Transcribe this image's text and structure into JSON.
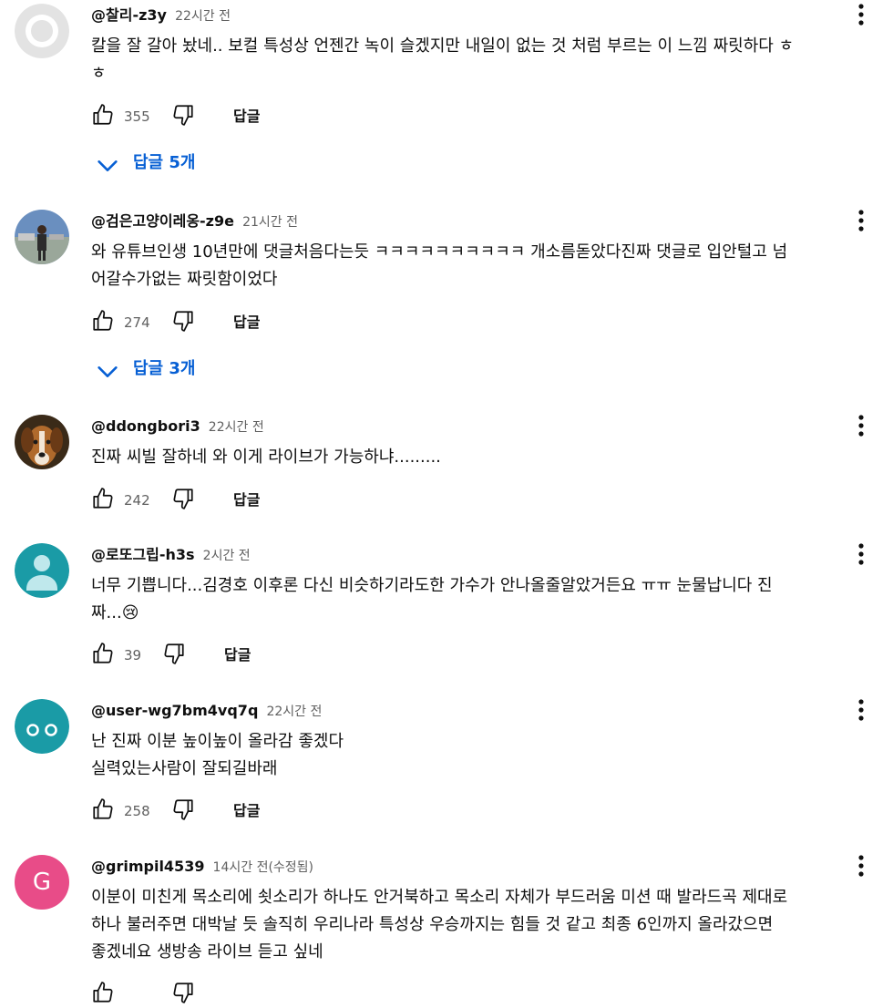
{
  "comments": [
    {
      "author": "@찰리-z3y",
      "time": "22시간 전",
      "text": "칼을 잘 갈아 놨네.. 보컬 특성상 언젠간 녹이 슬겠지만 내일이 없는 것 처럼 부르는 이 느낌 짜릿하다 ㅎ\nㅎ",
      "likes": "355",
      "reply_label": "답글",
      "replies_label": "답글 5개"
    },
    {
      "author": "@검은고양이레옹-z9e",
      "time": "21시간 전",
      "text": "와 유튜브인생 10년만에 댓글처음다는듯 ㅋㅋㅋㅋㅋㅋㅋㅋㅋㅋ 개소름돋았다진짜 댓글로 입안털고 넘\n어갈수가없는 짜릿함이었다",
      "likes": "274",
      "reply_label": "답글",
      "replies_label": "답글 3개"
    },
    {
      "author": "@ddongbori3",
      "time": "22시간 전",
      "text": "진짜 씨빌 잘하네 와 이게 라이브가 가능하냐.........",
      "likes": "242",
      "reply_label": "답글"
    },
    {
      "author": "@로또그립-h3s",
      "time": "2시간 전",
      "text": "너무 기쁩니다...김경호 이후론 다신 비슷하기라도한 가수가 안나올줄알았거든요 ㅠㅠ 눈물납니다 진\n짜...😢",
      "likes": "39",
      "reply_label": "답글"
    },
    {
      "author": "@user-wg7bm4vq7q",
      "time": "22시간 전",
      "text": "난 진짜 이분 높이높이 올라감 좋겠다\n실력있는사람이 잘되길바래",
      "likes": "258",
      "reply_label": "답글"
    },
    {
      "author": "@grimpil4539",
      "time": "14시간 전(수정됨)",
      "text": "이분이 미친게 목소리에 쇳소리가 하나도 안거북하고 목소리 자체가 부드러움 미션 때 발라드곡 제대로\n하나 불러주면 대박날 듯 솔직히 우리나라 특성상 우승까지는 힘들 것 같고 최종 6인까지 올라갔으면\n좋겠네요 생방송 라이브 듣고 싶네",
      "avatar_letter": "G",
      "avatar_color": "#e84c88"
    }
  ],
  "colors": {
    "text_primary": "#0f0f0f",
    "text_secondary": "#606060",
    "link_blue": "#065fd4",
    "avatar_teal": "#1a9ba6",
    "avatar_pink": "#e84c88",
    "avatar_gray": "#e3e3e3"
  }
}
